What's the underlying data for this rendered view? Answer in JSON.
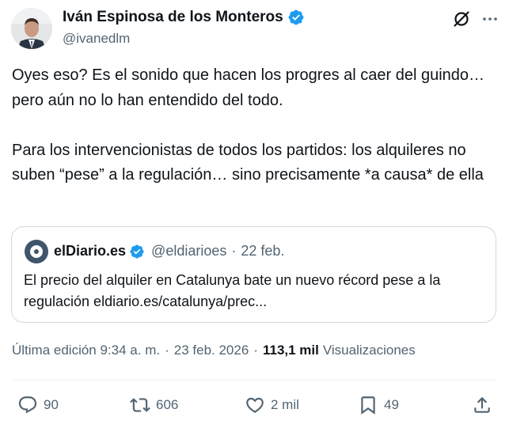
{
  "author": {
    "display_name": "Iván Espinosa de los Monteros",
    "handle": "@ivanedlm"
  },
  "tweet": {
    "text": "Oyes eso? Es el sonido que hacen los progres al caer del guindo… pero aún no lo han entendido del todo.\n\nPara los intervencionistas de todos los partidos: los alquileres no suben “pese” a la regulación… sino precisamente *a causa* de ella"
  },
  "quote": {
    "display_name": "elDiario.es",
    "handle": "@eldiarioes",
    "separator": "·",
    "date": "22 feb.",
    "text": "El precio del alquiler en Catalunya bate un nuevo récord pese a la regulación eldiario.es/catalunya/prec..."
  },
  "meta": {
    "edited_label": "Última edición 9:34 a. m.",
    "separator": "·",
    "date": "23 feb. 2026",
    "views_count": "113,1 mil",
    "views_label": "Visualizaciones"
  },
  "actions": {
    "replies": "90",
    "reposts": "606",
    "likes": "2 mil",
    "bookmarks": "49"
  },
  "colors": {
    "verified": "#1d9bf0",
    "text_primary": "#0f1419",
    "text_secondary": "#536471",
    "border": "#cfd9de"
  },
  "icons": [
    "verified-badge-icon",
    "grok-icon",
    "more-icon",
    "reply-icon",
    "repost-icon",
    "like-icon",
    "bookmark-icon",
    "share-icon"
  ]
}
